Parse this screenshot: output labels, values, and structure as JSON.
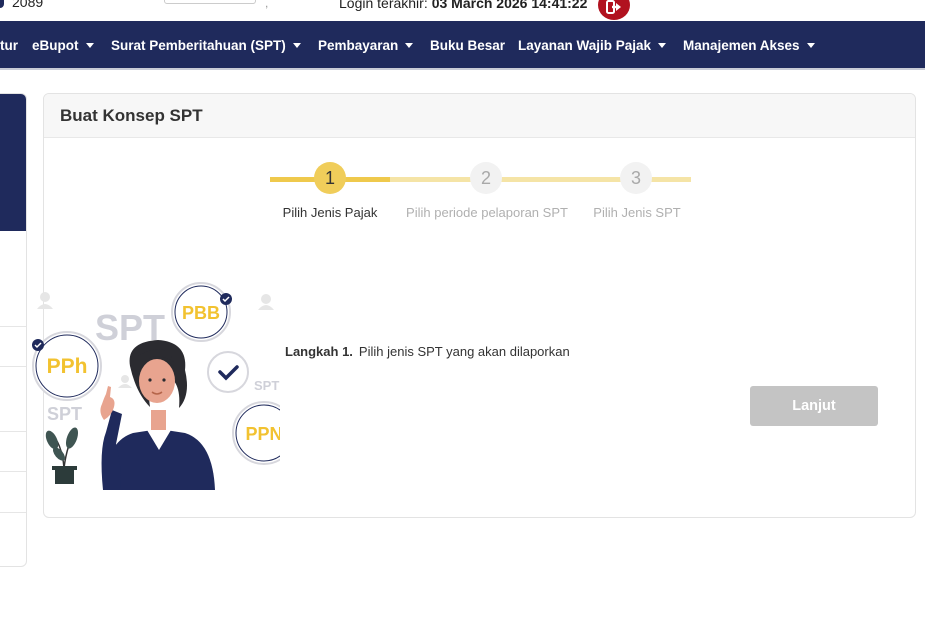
{
  "top": {
    "account_id": "2089",
    "login_label": "Login terakhir:",
    "login_time": "03 March 2026 14:41:22"
  },
  "nav": {
    "items": [
      {
        "label": "tur",
        "has_caret": false
      },
      {
        "label": "eBupot",
        "has_caret": true
      },
      {
        "label": "Surat Pemberitahuan (SPT)",
        "has_caret": true
      },
      {
        "label": "Pembayaran",
        "has_caret": true
      },
      {
        "label": "Buku Besar",
        "has_caret": false
      },
      {
        "label": "Layanan Wajib Pajak",
        "has_caret": true
      },
      {
        "label": "Manajemen Akses",
        "has_caret": true
      }
    ]
  },
  "card": {
    "title": "Buat Konsep SPT"
  },
  "stepper": {
    "steps": [
      {
        "number": "1",
        "label": "Pilih Jenis Pajak",
        "active": true
      },
      {
        "number": "2",
        "label": "Pilih periode pelaporan SPT",
        "active": false
      },
      {
        "number": "3",
        "label": "Pilih Jenis SPT",
        "active": false
      }
    ]
  },
  "illustration": {
    "labels": {
      "spt_big": "SPT",
      "pbb": "PBB",
      "pph": "PPh",
      "spt_small_left": "SPT",
      "spt_small_right": "SPT",
      "ppn": "PPN"
    }
  },
  "instruction": {
    "step_label": "Langkah 1.",
    "text": "Pilih jenis SPT yang akan dilaporkan"
  },
  "buttons": {
    "next": "Lanjut"
  },
  "colors": {
    "navbar": "#1f2a5c",
    "accent_yellow": "#f0cd5a",
    "logout_red": "#b1121f",
    "disabled_button": "#c4c4c4"
  }
}
